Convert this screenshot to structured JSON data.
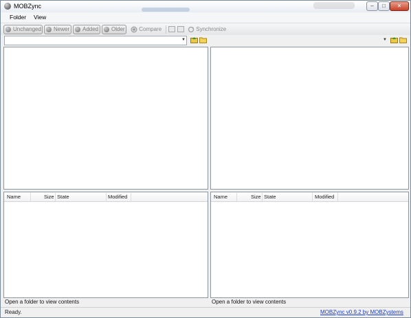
{
  "window": {
    "title": "MOBZync"
  },
  "menu": [
    {
      "label": "Folder"
    },
    {
      "label": "View"
    }
  ],
  "toolbar": {
    "filters": [
      {
        "label": "Unchanged"
      },
      {
        "label": "Newer"
      },
      {
        "label": "Added"
      },
      {
        "label": "Older"
      }
    ],
    "compare_label": "Compare",
    "synchronize_label": "Synchronize"
  },
  "left": {
    "path_value": "",
    "columns": [
      "Name",
      "Size",
      "State",
      "Modified"
    ],
    "status": "Open a folder to view contents"
  },
  "right": {
    "path_value": "",
    "columns": [
      "Name",
      "Size",
      "State",
      "Modified"
    ],
    "status": "Open a folder to view contents"
  },
  "statusbar": {
    "text": "Ready.",
    "link": "MOBZync v0.9.2 by MOBZystems"
  },
  "colors": {
    "link": "#1a3cc9",
    "pane_border": "#8c949e"
  }
}
